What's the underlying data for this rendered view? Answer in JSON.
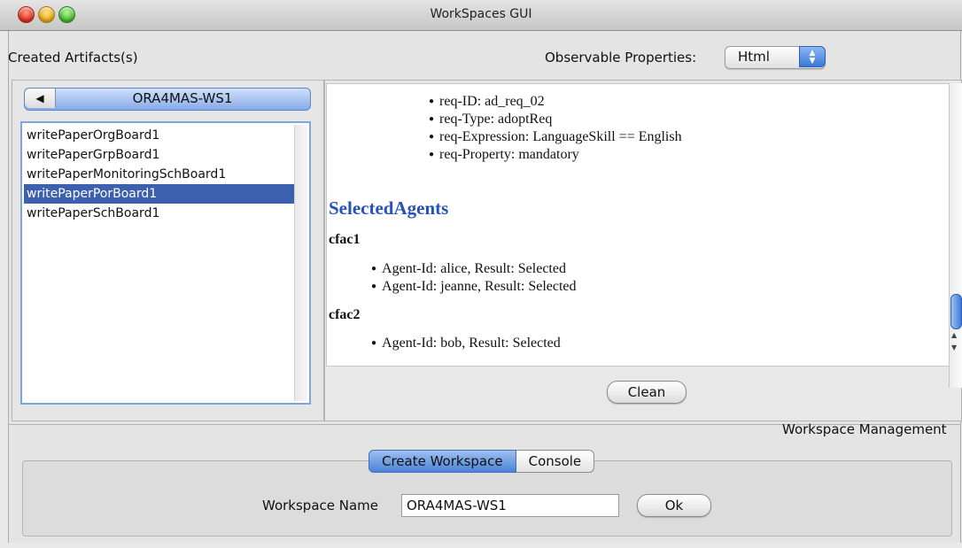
{
  "window": {
    "title": "WorkSpaces GUI"
  },
  "header": {
    "created_artifacts_label": "Created Artifacts(s)",
    "observable_properties_label": "Observable Properties:",
    "format_select": {
      "selected": "Html"
    }
  },
  "workspace_selector": {
    "name": "ORA4MAS-WS1"
  },
  "artifacts": [
    {
      "name": "writePaperOrgBoard1",
      "selected": false
    },
    {
      "name": "writePaperGrpBoard1",
      "selected": false
    },
    {
      "name": "writePaperMonitoringSchBoard1",
      "selected": false
    },
    {
      "name": "writePaperPorBoard1",
      "selected": true
    },
    {
      "name": "writePaperSchBoard1",
      "selected": false
    }
  ],
  "properties_view": {
    "requirement_bullets": [
      "req-ID: ad_req_02",
      "req-Type: adoptReq",
      "req-Expression: LanguageSkill == English",
      "req-Property: mandatory"
    ],
    "section_title": "SelectedAgents",
    "groups": [
      {
        "name": "cfac1",
        "agents": [
          "Agent-Id: alice, Result: Selected",
          "Agent-Id: jeanne, Result: Selected"
        ]
      },
      {
        "name": "cfac2",
        "agents": [
          "Agent-Id: bob, Result: Selected"
        ]
      }
    ]
  },
  "clean_button": "Clean",
  "workspace_management": {
    "title": "Workspace Management",
    "tabs": [
      {
        "label": "Create Workspace",
        "active": true
      },
      {
        "label": "Console",
        "active": false
      }
    ],
    "name_label": "Workspace Name",
    "name_value": "ORA4MAS-WS1",
    "ok_button": "Ok"
  }
}
